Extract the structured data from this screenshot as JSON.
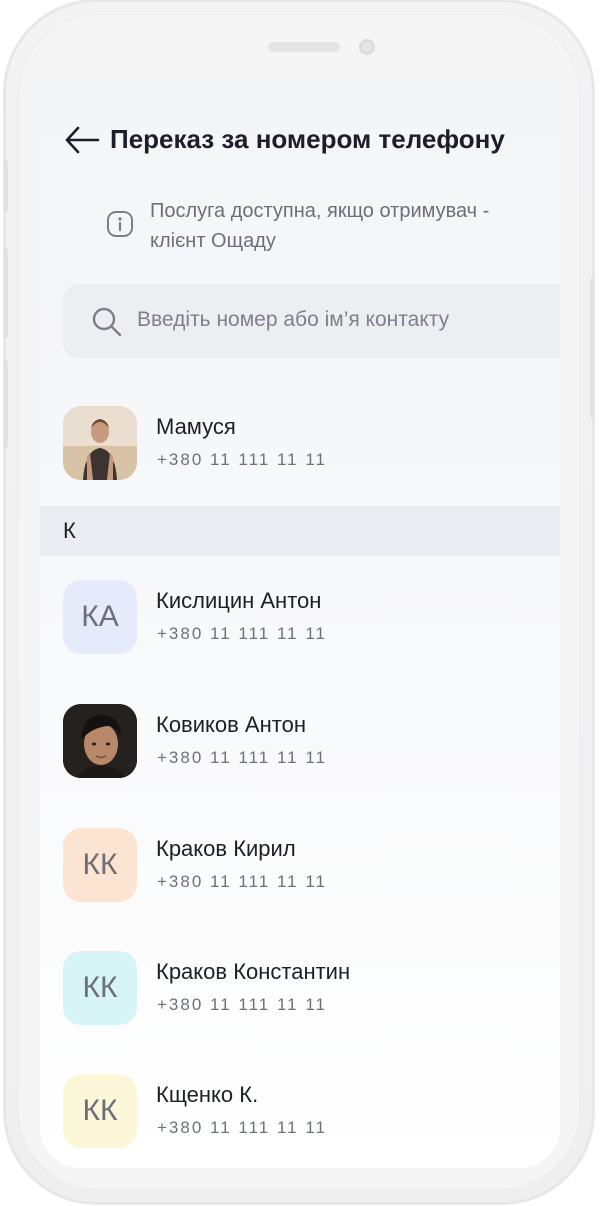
{
  "header": {
    "title": "Переказ за номером телефону"
  },
  "info": {
    "text": "Послуга доступна, якщо отримувач - клієнт Ощаду"
  },
  "search": {
    "placeholder": "Введіть номер або ім’я контакту"
  },
  "contacts_top": [
    {
      "name": "Мамуся",
      "phone": "+380 11 111 11 11",
      "avatar": "photo"
    }
  ],
  "section": {
    "label": "К"
  },
  "contacts": [
    {
      "name": "Кислицин Антон",
      "phone": "+380 11 111 11 11",
      "initials": "КА",
      "avatar_color": "#e6ebfb"
    },
    {
      "name": "Ковиков Антон",
      "phone": "+380 11 111 11 11",
      "avatar": "photo"
    },
    {
      "name": "Краков Кирил",
      "phone": "+380 11 111 11 11",
      "initials": "КК",
      "avatar_color": "#fce4d2"
    },
    {
      "name": "Краков Константин",
      "phone": "+380 11 111 11 11",
      "initials": "КК",
      "avatar_color": "#d6f4f6"
    },
    {
      "name": "Кщенко К.",
      "phone": "+380 11 111 11 11",
      "initials": "КК",
      "avatar_color": "#fdf7d9"
    }
  ],
  "icons": {
    "back": "arrow-left-icon",
    "info": "info-icon",
    "search": "search-icon"
  }
}
